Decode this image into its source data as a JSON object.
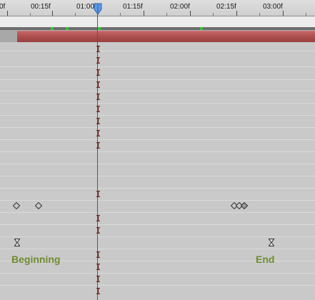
{
  "ruler": {
    "ticks": [
      "0f",
      "00:15f",
      "01:00f",
      "01:15f",
      "02:00f",
      "02:15f",
      "03:00f"
    ]
  },
  "labels": {
    "beginning": "Beginning",
    "end": "End"
  },
  "icons": {
    "playhead": "current-time-indicator-icon",
    "hold_keyframe": "hold-keyframe-icon",
    "keyframe": "keyframe-diamond-icon",
    "hourglass": "hourglass-keyframe-icon"
  },
  "colors": {
    "layer_bar": "#b45555",
    "current_time_line": "#e02010",
    "marker": "#35c335",
    "label": "#6e8b2e",
    "playhead": "#5b9be8"
  }
}
